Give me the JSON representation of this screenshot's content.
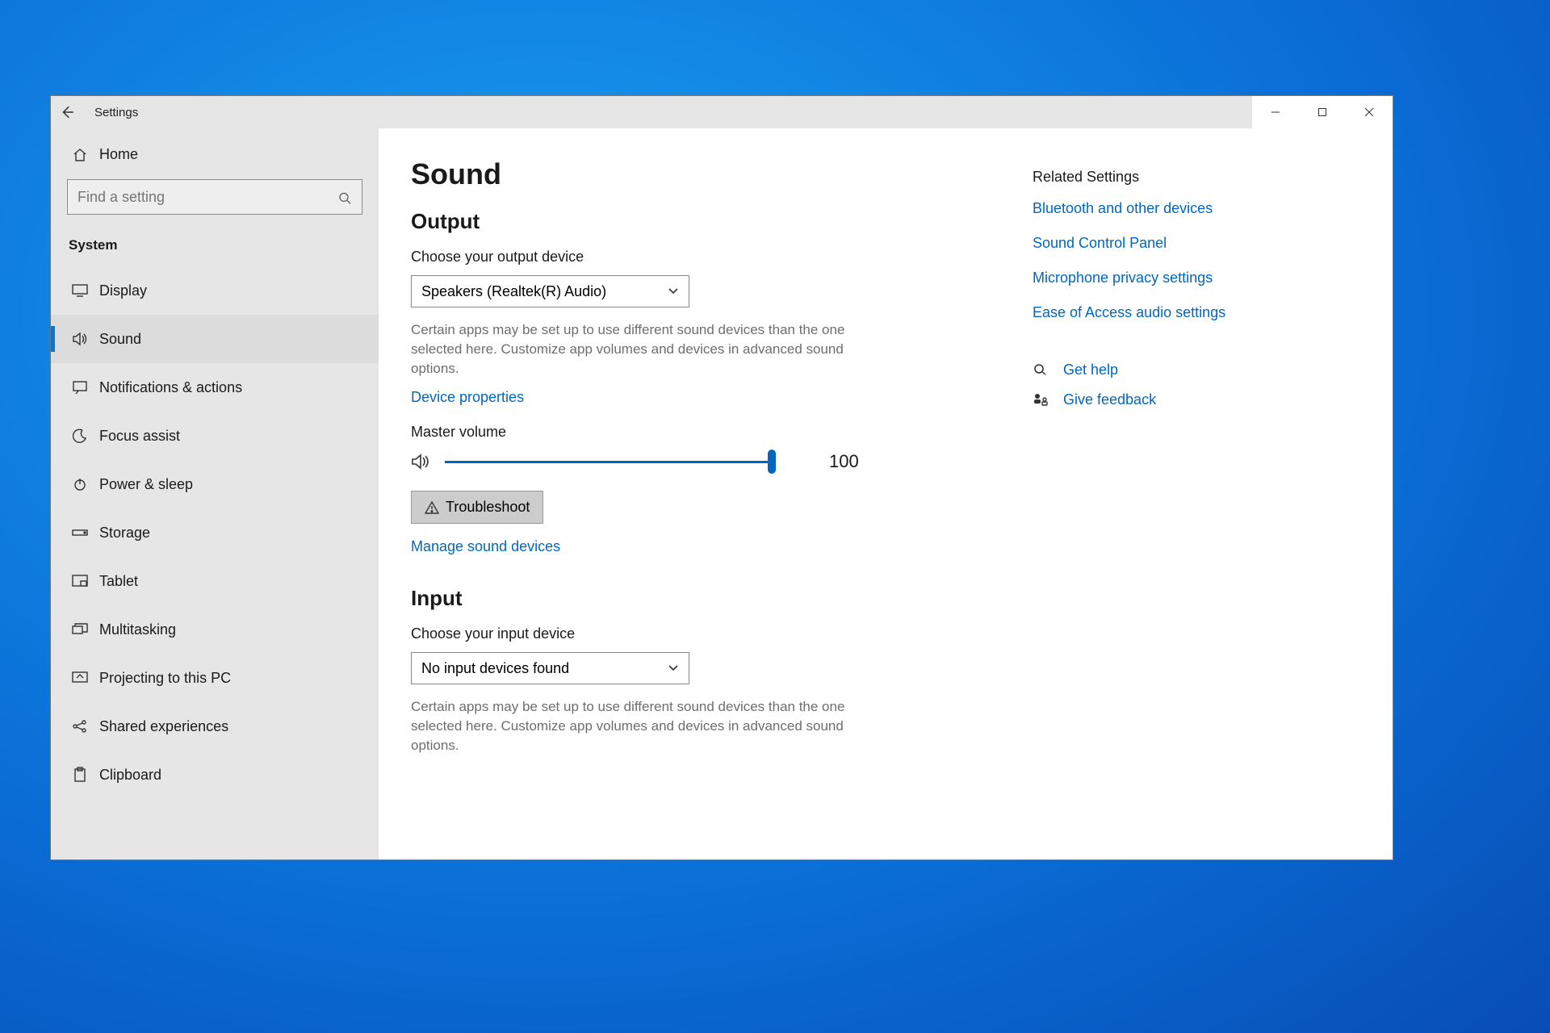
{
  "window": {
    "app_title": "Settings"
  },
  "sidebar": {
    "home_label": "Home",
    "search_placeholder": "Find a setting",
    "category_label": "System",
    "items": [
      {
        "label": "Display"
      },
      {
        "label": "Sound"
      },
      {
        "label": "Notifications & actions"
      },
      {
        "label": "Focus assist"
      },
      {
        "label": "Power & sleep"
      },
      {
        "label": "Storage"
      },
      {
        "label": "Tablet"
      },
      {
        "label": "Multitasking"
      },
      {
        "label": "Projecting to this PC"
      },
      {
        "label": "Shared experiences"
      },
      {
        "label": "Clipboard"
      }
    ]
  },
  "main": {
    "page_title": "Sound",
    "output": {
      "heading": "Output",
      "choose_label": "Choose your output device",
      "dropdown_value": "Speakers (Realtek(R) Audio)",
      "helper": "Certain apps may be set up to use different sound devices than the one selected here. Customize app volumes and devices in advanced sound options.",
      "device_props_link": "Device properties",
      "master_volume_label": "Master volume",
      "volume_value": "100",
      "troubleshoot_label": "Troubleshoot",
      "manage_link": "Manage sound devices"
    },
    "input": {
      "heading": "Input",
      "choose_label": "Choose your input device",
      "dropdown_value": "No input devices found",
      "helper": "Certain apps may be set up to use different sound devices than the one selected here. Customize app volumes and devices in advanced sound options."
    }
  },
  "right": {
    "heading": "Related Settings",
    "links": [
      "Bluetooth and other devices",
      "Sound Control Panel",
      "Microphone privacy settings",
      "Ease of Access audio settings"
    ],
    "get_help": "Get help",
    "give_feedback": "Give feedback"
  }
}
